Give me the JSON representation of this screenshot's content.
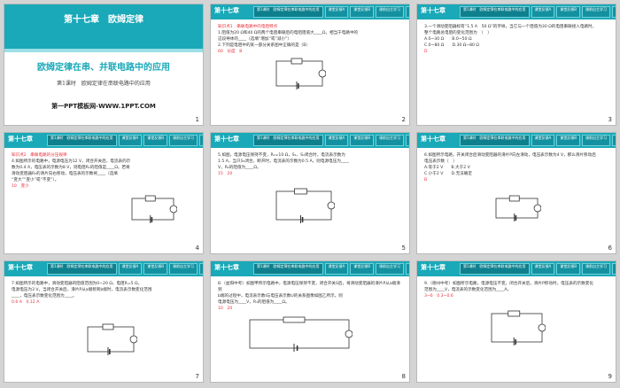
{
  "title_slide": {
    "chapter": "第十七章　欧姆定律",
    "title": "欧姆定律在串、并联电路中的应用",
    "subtitle": "第1课时　欧姆定律在串联电路中的应用",
    "brand": "第一PPT模板网-WWW.1PPT.COM",
    "number": "1"
  },
  "header": {
    "chapter": "第十七章",
    "tabs": [
      "第1课时　欧姆定律在串联电路中的应用",
      "课堂反馈A",
      "课堂反馈B",
      "课前自主学习",
      "课堂互动探究"
    ]
  },
  "slides": [
    {
      "number": "2",
      "kp": "知识点1　串联电路中的电阻特点",
      "lines": [
        "1.阻值为20 Ω和40 Ω的两个电阻串联后的电阻阻值大____Ω，相当于电路中的",
        "这段导体的____（选填“增加”或“减小”）",
        "2.下列是电阻中的某一部分关系图中正确的是（B）"
      ],
      "answers": [
        "60",
        "长度",
        "B"
      ]
    },
    {
      "number": "3",
      "lines": [
        "3.一个滑动变阻器标有“1.5 A　50 Ω”的字样，当它与一个阻值为30 Ω的电阻串联接入电路时，",
        "整个电路总电阻的变化范围为　（　）",
        "A.0~30 Ω　　B.0~50 Ω",
        "C.0~80 Ω　　D.30 Ω~80 Ω"
      ],
      "answers": [
        "D"
      ]
    },
    {
      "number": "4",
      "kp": "知识点2　串联电路的分压规律",
      "lines": [
        "4.如图所示的电路中，电源电压为12 V，闭合开关后，电流表的示",
        "数为0.4 A，电压表的示数为8 V，则电阻R₁的阻值是____Ω。若将",
        "滑动变阻器R₂的滑片向右移动，电压表的示数将____（选填",
        "“变大”“变小”或“不变”）。"
      ],
      "answers": [
        "10",
        "变小"
      ]
    },
    {
      "number": "5",
      "lines": [
        "5.如图，电源电压保持不变，R₁=10 Ω，S₁、S₂闭合时，电流表示数为",
        "1.5 A，当只S₁闭合，断开时，电流表的示数为0.5 A，则电源电压为____",
        "V，R₂的阻值为____Ω。"
      ],
      "answers": [
        "15",
        "20"
      ]
    },
    {
      "number": "6",
      "lines": [
        "6.如图所示电路，开关闭合后滑动变阻器的滑片P向左滑动，电压表示数为4 V，那么滑片移动后",
        "电压表示数（　）",
        "A.等于2 V　　B.大于2 V",
        "C.小于2 V　　D.无法确定"
      ],
      "answers": [
        "B"
      ]
    },
    {
      "number": "7",
      "lines": [
        "7.如图所示的电路中，滑动变阻器的阻值范围为0~20 Ω，电阻R=5 Ω，",
        "电源电压为3 V，当闭合开关后，滑片P从a端移到b端时，电流表示数变化范围",
        "____，电压表示数变化范围为____。"
      ],
      "answers": [
        "0.6 A",
        "0.12 A"
      ]
    },
    {
      "number": "8",
      "lines": [
        "8.（益阳中考）如图甲所示电路中，电源电压保持不变，闭合开关S后，将滑动变阻器的滑片P从a端滑到",
        "b端的过程中，电流表示数I与电压表示数U的关系图像如图乙所示，则",
        "电源电压为____V，R₁的阻值为____Ω。"
      ],
      "answers": [
        "10",
        "20"
      ]
    },
    {
      "number": "9",
      "lines": [
        "9.（德州中考）如图所示电路，电源电压不变，闭合开关后，滑片P移动时，电压表的示数变化",
        "范围为____V，电流表的示数变化范围为____A。"
      ],
      "answers": [
        "3~6",
        "0.3~0.6"
      ]
    }
  ]
}
